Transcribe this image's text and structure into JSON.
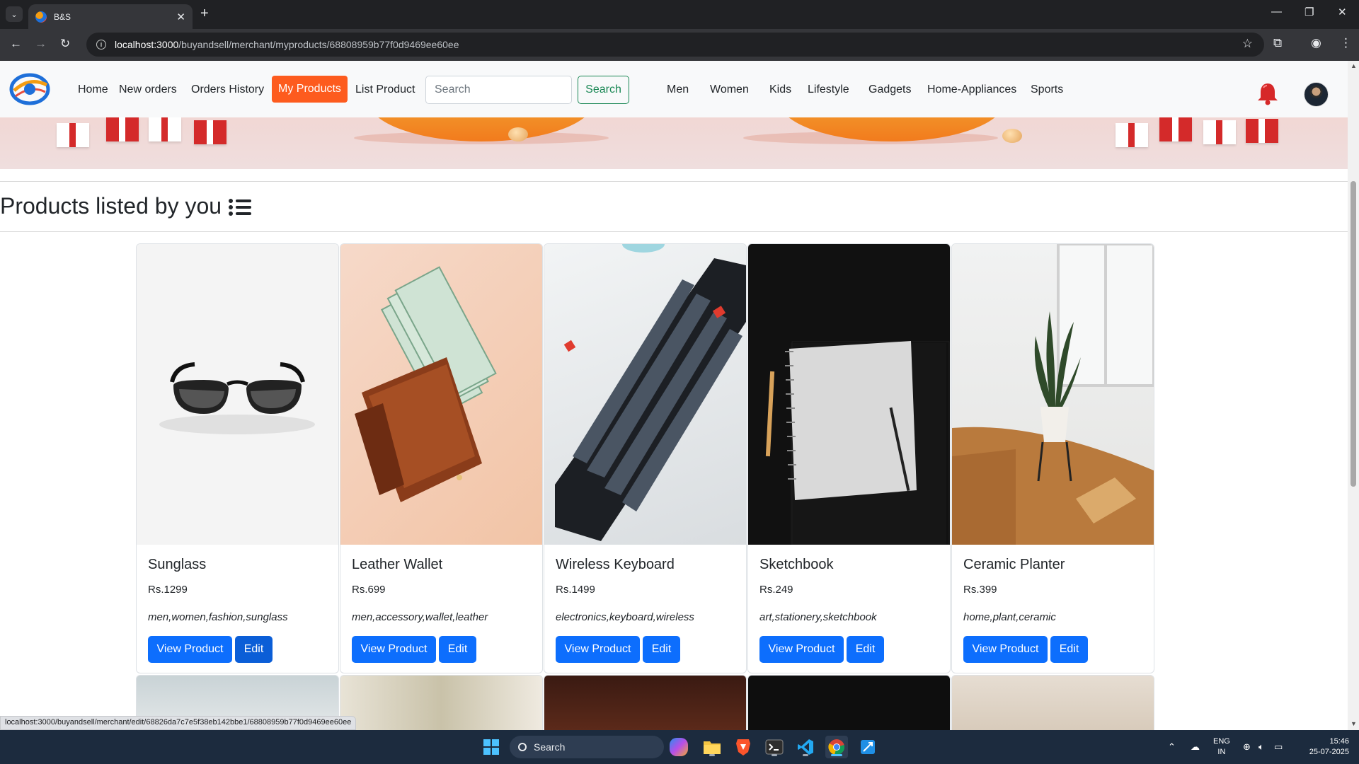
{
  "browser": {
    "tab_title": "B&S",
    "url_host": "localhost:3000",
    "url_path": "/buyandsell/merchant/myproducts/68808959b77f0d9469ee60ee",
    "status_url": "localhost:3000/buyandsell/merchant/edit/68826da7c7e5f38eb142bbe1/68808959b77f0d9469ee60ee"
  },
  "navbar": {
    "links": [
      "Home",
      "New orders",
      "Orders History",
      "My Products",
      "List Product"
    ],
    "active_link": "My Products",
    "search_placeholder": "Search",
    "search_button": "Search",
    "categories": [
      "Men",
      "Women",
      "Kids",
      "Lifestyle",
      "Gadgets",
      "Home-Appliances",
      "Sports"
    ]
  },
  "main": {
    "heading": "Products listed by you"
  },
  "products": [
    {
      "name": "Sunglass",
      "price": "Rs.1299",
      "tags": "men,women,fashion,sunglass",
      "view_label": "View Product",
      "edit_label": "Edit"
    },
    {
      "name": "Leather Wallet",
      "price": "Rs.699",
      "tags": "men,accessory,wallet,leather",
      "view_label": "View Product",
      "edit_label": "Edit"
    },
    {
      "name": "Wireless Keyboard",
      "price": "Rs.1499",
      "tags": "electronics,keyboard,wireless",
      "view_label": "View Product",
      "edit_label": "Edit"
    },
    {
      "name": "Sketchbook",
      "price": "Rs.249",
      "tags": "art,stationery,sketchbook",
      "view_label": "View Product",
      "edit_label": "Edit"
    },
    {
      "name": "Ceramic Planter",
      "price": "Rs.399",
      "tags": "home,plant,ceramic",
      "view_label": "View Product",
      "edit_label": "Edit"
    }
  ],
  "taskbar": {
    "search_label": "Search",
    "lang_top": "ENG",
    "lang_bottom": "IN",
    "time": "15:46",
    "date": "25-07-2025"
  },
  "colors": {
    "active_nav": "#fd5b1e",
    "primary_button": "#0d6efd",
    "search_button": "#198754",
    "bell": "#d62828"
  }
}
